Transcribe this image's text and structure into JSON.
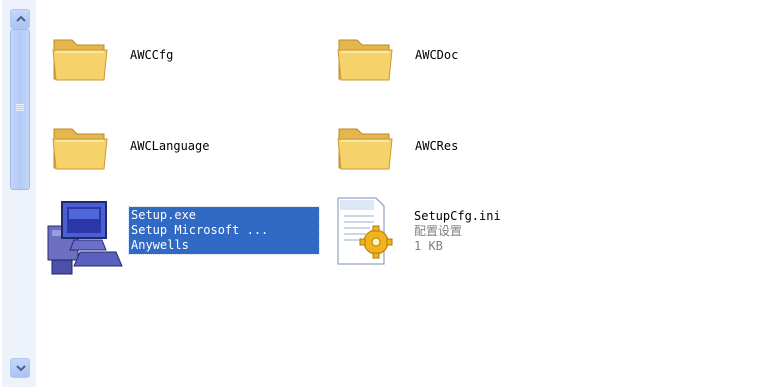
{
  "files": [
    {
      "name": "AWCCfg",
      "type": "folder"
    },
    {
      "name": "AWCDoc",
      "type": "folder"
    },
    {
      "name": "AWCLanguage",
      "type": "folder"
    },
    {
      "name": "AWCRes",
      "type": "folder"
    },
    {
      "name": "Setup.exe",
      "description": "Setup Microsoft ...",
      "company": "Anywells",
      "type": "executable",
      "selected": true
    },
    {
      "name": "SetupCfg.ini",
      "description": "配置设置",
      "size": "1 KB",
      "type": "config-file"
    }
  ],
  "colors": {
    "selection": "#316ac5",
    "folder": "#f6d36a",
    "scrollbar": "#c5d7fb"
  }
}
